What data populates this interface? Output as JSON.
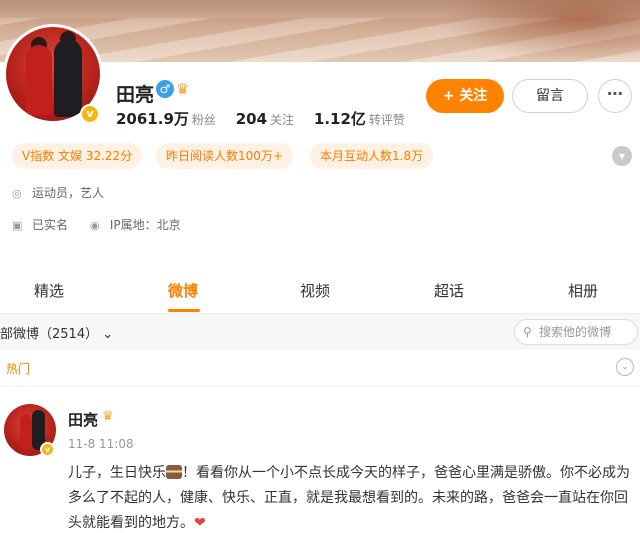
{
  "profile": {
    "name": "田亮",
    "stats": {
      "fans_value": "2061.9万",
      "fans_label": "粉丝",
      "following_value": "204",
      "following_label": "关注",
      "reposts_value": "1.12亿",
      "reposts_label": "转评赞"
    },
    "follow_button": "+ 关注",
    "message_button": "留言",
    "more_button": "⋯"
  },
  "tags": {
    "v_index": "V指数 文娱 32.22分",
    "yesterday_reads": "昨日阅读人数100万+",
    "monthly_interact": "本月互动人数1.8万"
  },
  "info": {
    "occupation": "运动员，艺人",
    "real_name": "已实名",
    "ip_location": "IP属地：北京"
  },
  "tabs": [
    "精选",
    "微博",
    "视频",
    "超话",
    "相册"
  ],
  "active_tab": "微博",
  "filter": {
    "label": "部微博（2514）",
    "search_placeholder": "搜索他的微博"
  },
  "hot_label": "热门",
  "post": {
    "author": "田亮",
    "time": "11-8 11:08",
    "text_part1": "儿子，生日快乐",
    "text_part2": "！看看你从一个小不点长成今天的样子，爸爸心里满是骄傲。你不必成为多么了不起的人，健康、快乐、正直，就是我最想看到的。未来的路，爸爸会一直站在你回头就能看到的地方。"
  },
  "colors": {
    "accent": "#ff8200",
    "verified": "#f6b618",
    "gender": "#3aa0e9"
  }
}
